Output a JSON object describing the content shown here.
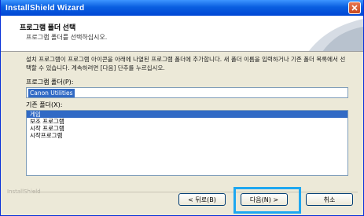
{
  "window": {
    "title": "InstallShield Wizard"
  },
  "header": {
    "title": "프로그램 폴더 선택",
    "subtitle": "프로그램 폴더를 선택하십시오."
  },
  "description": "설치 프로그램이 프로그램 아이콘을 아래에 나열된 프로그램 폴더에 추가합니다. 새 폴더 이름을 입력하거나 기존 폴더 목록에서 선택할 수 있습니다. 계속하려면 [다음] 단추를 누르십시오.",
  "folder": {
    "label": "프로그램 폴더(P):",
    "value": "Canon Utilities"
  },
  "existing": {
    "label": "기존 폴더(X):",
    "items": [
      "게임",
      "보조 프로그램",
      "시작 프로그램",
      "시작프로그램"
    ]
  },
  "footer": {
    "brand": "InstallShield"
  },
  "buttons": {
    "back": "< 뒤로(B)",
    "next": "다음(N) >",
    "cancel": "취소"
  },
  "colors": {
    "selection": "#316ac5",
    "highlight": "#1ea7f0",
    "titlebar": "#0a5fe0"
  }
}
